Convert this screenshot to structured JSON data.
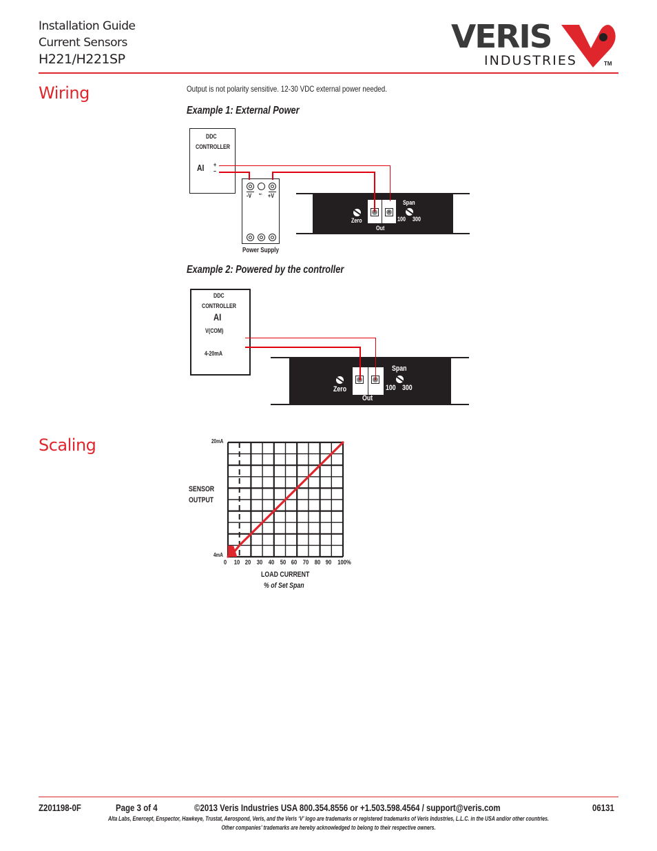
{
  "header": {
    "line1": "Installation Guide",
    "line2": "Current Sensors",
    "line3": "H221/H221SP",
    "logo": {
      "brand": "VERIS",
      "sub": "INDUSTRIES",
      "tm": "TM",
      "icon": "veris-v-logo-icon"
    }
  },
  "colors": {
    "accent": "#e0262d",
    "wire": "#e0000f",
    "ink": "#231f20"
  },
  "wiring": {
    "title": "Wiring",
    "note": "Output is not polarity sensitive. 12-30 VDC external power needed.",
    "example1": {
      "title": "Example 1:  External Power",
      "controller": {
        "line1": "DDC",
        "line2": "CONTROLLER",
        "ai": "AI",
        "plus": "+",
        "minus": "–"
      },
      "power_supply": {
        "label": "Power Supply",
        "neg": "-V",
        "nc": "NC",
        "pos": "+V"
      },
      "sensor": {
        "zero": "Zero",
        "span": "Span",
        "out": "Out",
        "range_low": "100",
        "range_high": "300"
      }
    },
    "example2": {
      "title": "Example 2: Powered by the controller",
      "controller": {
        "line1": "DDC",
        "line2": "CONTROLLER",
        "ai": "AI",
        "vcom": "V(COM)",
        "ma": "4-20mA"
      },
      "sensor": {
        "zero": "Zero",
        "span": "Span",
        "out": "Out",
        "range_low": "100",
        "range_high": "300"
      }
    }
  },
  "scaling": {
    "title": "Scaling"
  },
  "chart_data": {
    "type": "line",
    "title": "",
    "xlabel": "LOAD CURRENT",
    "xlabel_sub": "% of Set Span",
    "ylabel": [
      "SENSOR",
      "OUTPUT"
    ],
    "x_ticks": [
      "0",
      "10",
      "20",
      "30",
      "40",
      "50",
      "60",
      "70",
      "80",
      "90",
      "100%"
    ],
    "y_ticks": [
      "4mA",
      "20mA"
    ],
    "xlim": [
      0,
      100
    ],
    "ylim": [
      4,
      20
    ],
    "grid": true,
    "dashed_reference_x": 10,
    "series": [
      {
        "name": "Sensor output",
        "x": [
          0,
          5,
          10,
          100
        ],
        "y": [
          4,
          4.6,
          5.6,
          20
        ]
      }
    ],
    "deadband_fill": {
      "x": [
        0,
        8
      ],
      "y": [
        4,
        5.5
      ]
    }
  },
  "footer": {
    "doc_id": "Z201198-0F",
    "page": "Page 3 of 4",
    "contact": "©2013 Veris Industries   USA 800.354.8556 or +1.503.598.4564  / support@veris.com",
    "code": "06131",
    "trademark1": "Alta Labs, Enercept, Enspector, Hawkeye, Trustat, Aerospond, Veris, and the Veris ‘V’ logo are trademarks or registered trademarks of  Veris Industries, L.L.C. in the USA and/or other countries.",
    "trademark2": "Other companies’ trademarks are hereby acknowledged to belong to their respective owners."
  }
}
